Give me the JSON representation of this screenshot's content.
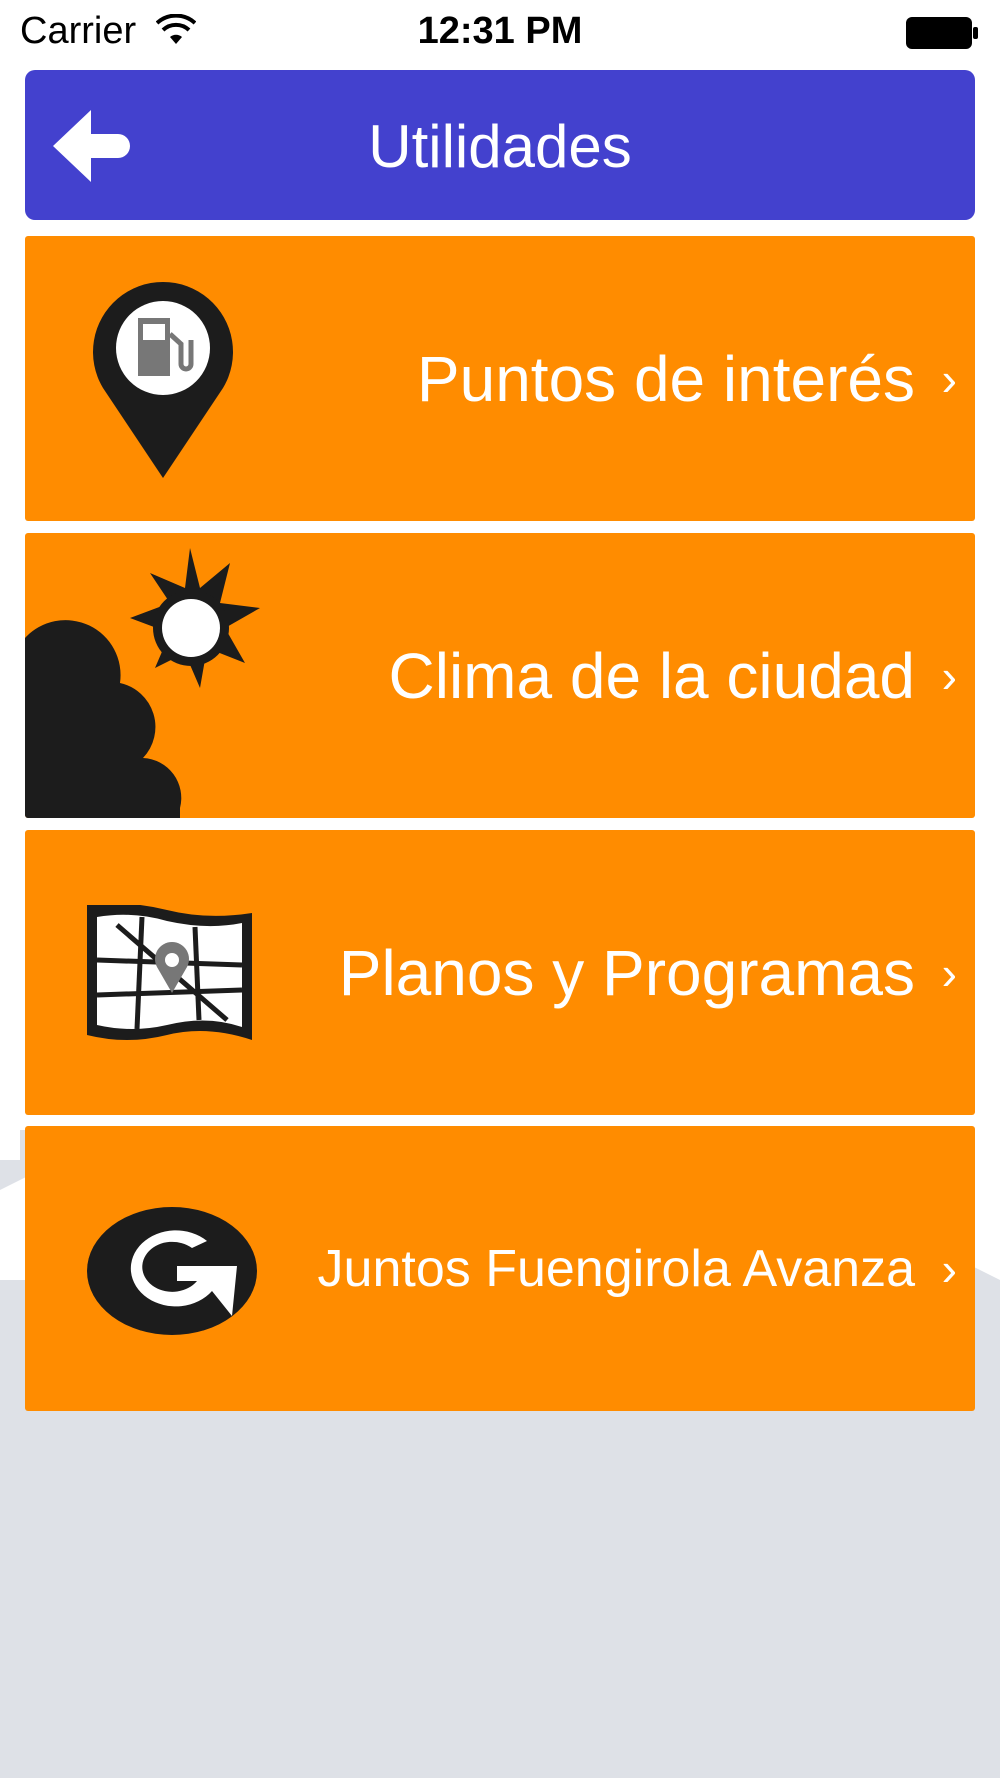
{
  "status_bar": {
    "carrier": "Carrier",
    "time": "12:31 PM",
    "wifi_icon": "wifi-icon",
    "battery_icon": "battery-icon"
  },
  "header": {
    "title": "Utilidades",
    "back_icon": "arrow-left-icon",
    "color": "#4341CE"
  },
  "menu": {
    "accent": "#FF8C00",
    "items": [
      {
        "label": "Puntos de interés",
        "icon": "gas-station-pin-icon"
      },
      {
        "label": "Clima de la ciudad",
        "icon": "sun-cloud-icon"
      },
      {
        "label": "Planos y Programas",
        "icon": "map-icon"
      },
      {
        "label": "Juntos Fuengirola Avanza",
        "icon": "g-logo-icon"
      }
    ],
    "chevron": "›"
  }
}
